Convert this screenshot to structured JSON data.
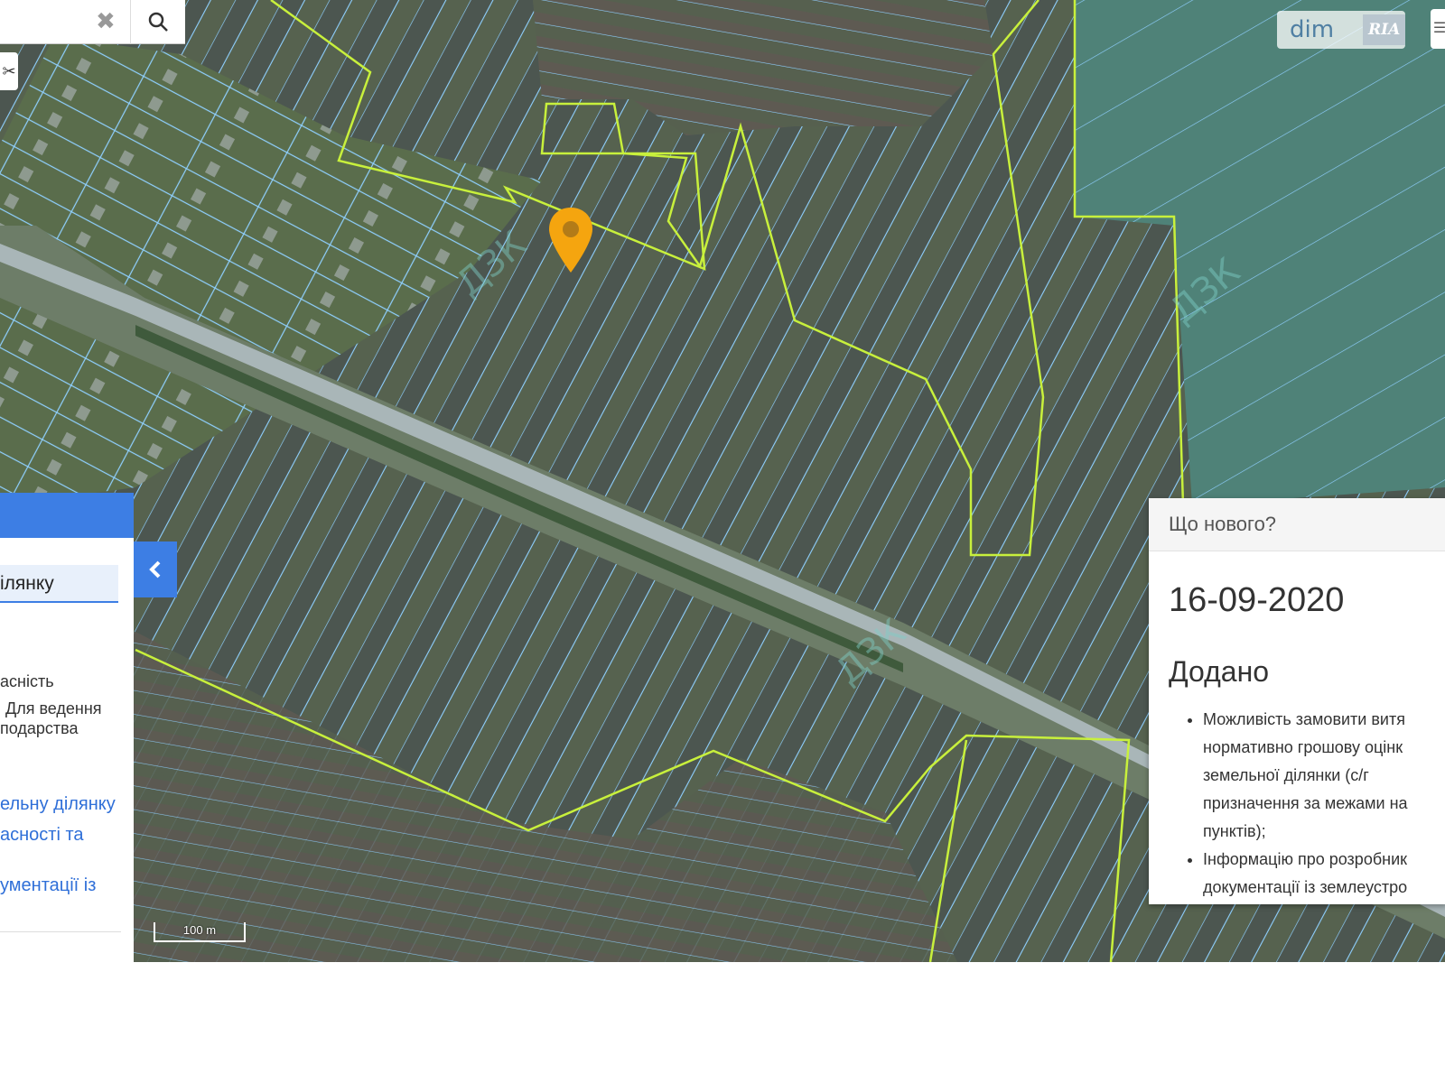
{
  "search": {
    "clear_icon": "close-icon",
    "button_icon": "search-icon"
  },
  "map": {
    "marker_icon": "location-pin-icon",
    "scale_label": "100 m",
    "watermark": "ДЗК"
  },
  "logo": {
    "dim": "dim",
    "ria": "RIA"
  },
  "side_panel": {
    "input_text": "ілянку",
    "info_line1": "асність",
    "info_line2": "Для ведення",
    "info_line3": "подарства",
    "link1_line1": "ельну ділянку",
    "link1_line2": "асності та",
    "link2": "ументації із",
    "collapse_icon": "chevron-left-icon"
  },
  "news": {
    "title": "Що нового?",
    "date": "16-09-2020",
    "section": "Додано",
    "items": [
      "Можливість замовити витя\nнормативно грошову оцінк\nземельної ділянки (с/г\nпризначення за межами на\nпунктів);",
      "Інформацію про розробник\nдокументації із землеустро"
    ]
  },
  "colors": {
    "parcel_outline": "#8fd0ff",
    "boundary": "#c8f03c",
    "marker": "#f5a50f",
    "accent": "#3d7ee4"
  }
}
